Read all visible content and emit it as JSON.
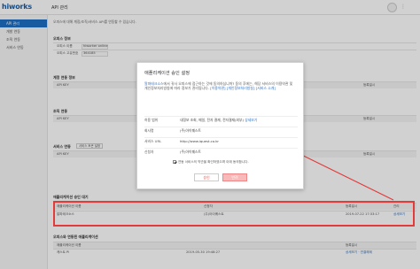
{
  "app": {
    "logo": "hiworks",
    "title": "API 관리"
  },
  "sidebar": {
    "items": [
      {
        "label": "API 관리",
        "active": true
      },
      {
        "label": "개발 연동"
      },
      {
        "label": "조직 연동"
      },
      {
        "label": "서비스 연동"
      }
    ]
  },
  "main": {
    "description": "오피스에 대해 계정/조직/서비스 API를 연동할 수 있습니다.",
    "office_info": {
      "title": "오피스 정보",
      "rows": [
        {
          "label": "오피스 이름",
          "value": "hiworker online"
        },
        {
          "label": "오피스 고유번호",
          "value": "364185"
        }
      ]
    },
    "dev_section": {
      "title": "계정 연동 정보",
      "head": [
        "API KEY",
        "등록일시"
      ],
      "row": {
        "key": "API KEY"
      }
    },
    "org_section": {
      "title": "조직 연동",
      "link": "조직 연동 설정",
      "head": [
        "API KEY",
        "등록일시"
      ],
      "row": {
        "key": "API KEY"
      }
    },
    "service_section": {
      "title": "서비스 연동",
      "link": "서비스 토큰 설정",
      "head": [
        "API KEY",
        "등록일시"
      ]
    },
    "pending": {
      "title": "애플리케이션 승인 대기",
      "head": [
        "애플리케이션 이름",
        "신청자",
        "등록일시",
        "관리"
      ],
      "row": {
        "name": "알파테크소스",
        "applicant": "(주)아이퀘스트",
        "date": "2019-07-22 17:33:17",
        "action": "상세보기"
      }
    },
    "connected": {
      "title": "오피스와 연동된 애플리케이션",
      "head": [
        "애플리케이션 이름",
        "등록일시"
      ],
      "row": {
        "name": "캐스트 Pi",
        "date": "2019-05-30 19:48:27",
        "action": "상세보기 · 연결해제"
      }
    }
  },
  "modal": {
    "title": "애플리케이션 승인 설정",
    "text_app": "알파테크소스",
    "text_body": "에서 귀사 오피스에 접근하는 것에 동의하십니까? 동의 후에는, 해당 서비스의 이용약관 및 개인정보처리방침에 따라 정보가 관리됩니다.",
    "text_link1": "[이용약관]",
    "text_link2": "[개인정보처리방침]",
    "text_link3": "[서비스 소개]",
    "rows": [
      {
        "label": "허용 범위",
        "value": "내정보 조회, 메일, 전자 결재, 전자결재(외부)",
        "link": "상세보기"
      },
      {
        "label": "회사명",
        "value": "(주)아이퀘스트"
      },
      {
        "label": "서비스 URL",
        "value": "http://www.iquest.co.kr"
      },
      {
        "label": "신청자",
        "value": "(주)아이퀘스트"
      }
    ],
    "consent": "연동 서비스의 약관을 확인하였으며 이에 동의합니다.",
    "approve": "승인",
    "reject": "반려"
  },
  "colors": {
    "accent": "#1f6fc5",
    "highlight": "#e33a3a",
    "reject_bg": "#f7b9b9"
  }
}
